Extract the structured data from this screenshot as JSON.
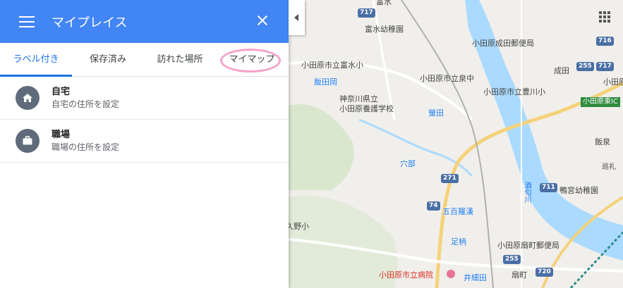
{
  "header": {
    "title": "マイプレイス"
  },
  "tabs": [
    {
      "label": "ラベル付き"
    },
    {
      "label": "保存済み"
    },
    {
      "label": "訪れた場所"
    },
    {
      "label": "マイマップ"
    }
  ],
  "places": [
    {
      "name": "自宅",
      "sub": "自宅の住所を設定",
      "icon": "home-icon"
    },
    {
      "name": "職場",
      "sub": "職場の住所を設定",
      "icon": "briefcase-icon"
    }
  ],
  "map": {
    "labels": {
      "school1": "富水幼稚園",
      "post1": "小田原成田郵便局",
      "school2": "小田原市立富水小",
      "school3": "小田原市立泉中",
      "station1": "飯田岡",
      "school4": "小田原市立豊川小",
      "area1": "成田",
      "school5": "神奈川県立\n小田原養護学校",
      "station2": "螢田",
      "area2": "飯泉",
      "station3": "穴部",
      "river": "酒匂川",
      "school6": "鴨宮幼稚園",
      "station4": "五百羅漢",
      "area3": "久野小",
      "station5": "足柄",
      "post2": "小田原扇町郵便局",
      "hospital": "小田原市立病院",
      "station6": "井細田",
      "area4": "扇町",
      "ic": "小田原東IC",
      "school7": "小田原市立",
      "area5": "巡礼",
      "topcut": "富水"
    },
    "shields": [
      "717",
      "716",
      "255",
      "717",
      "271",
      "74",
      "711",
      "255",
      "720"
    ]
  },
  "colors": {
    "header": "#4285f4",
    "accent": "#1a73e8",
    "circle": "#f3a3c8"
  }
}
